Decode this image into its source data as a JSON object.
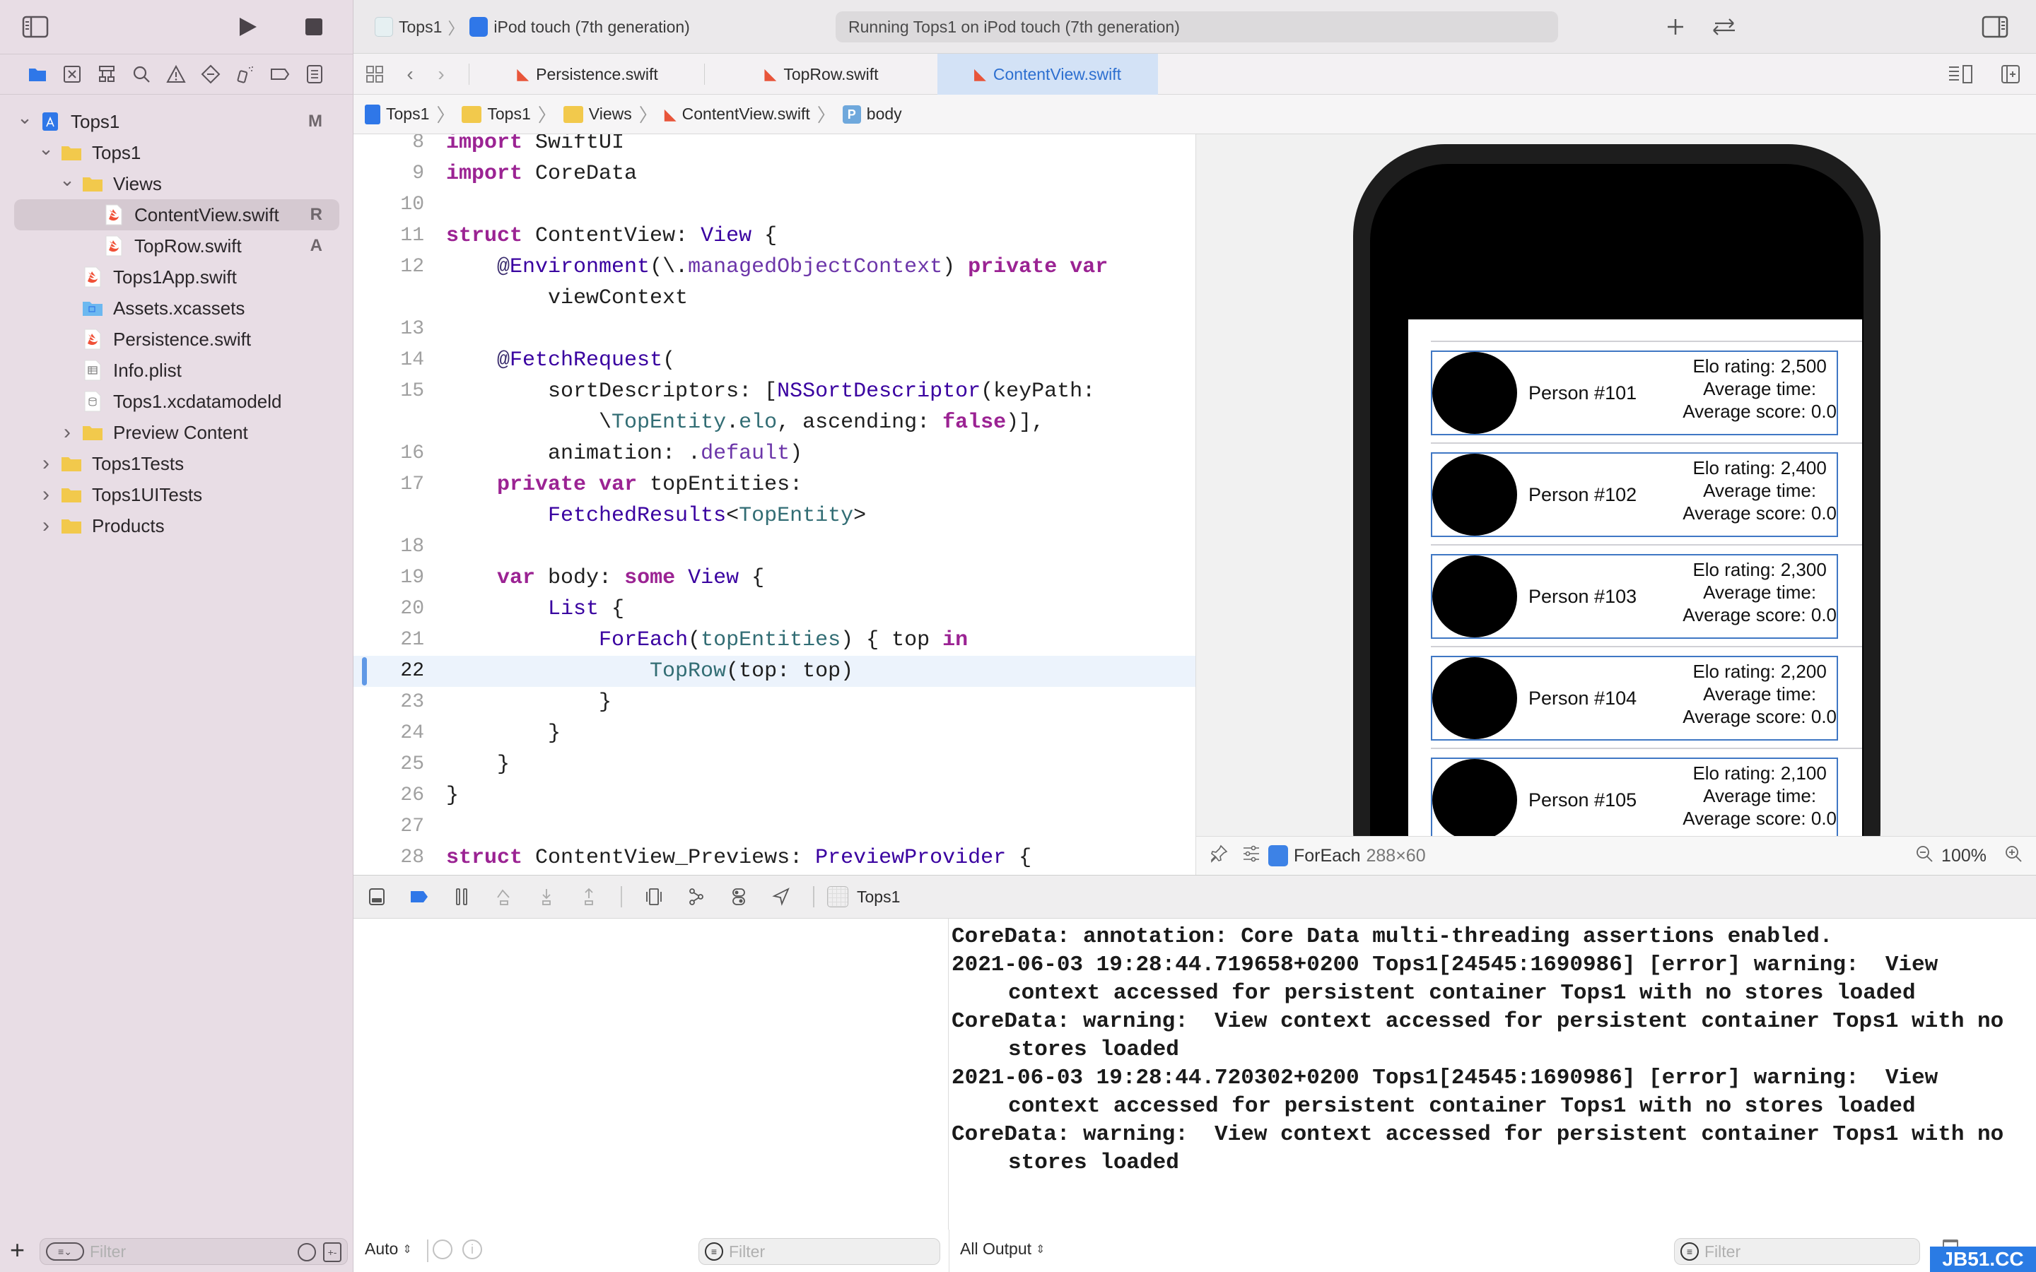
{
  "toolbar": {
    "scheme_project": "Tops1",
    "scheme_device": "iPod touch (7th generation)",
    "activity_status": "Running Tops1 on iPod touch (7th generation)"
  },
  "navigator": {
    "tree": [
      {
        "label": "Tops1",
        "level": 0,
        "expanded": true,
        "icon": "project-icon",
        "badge": "M"
      },
      {
        "label": "Tops1",
        "level": 1,
        "expanded": true,
        "icon": "folder-icon"
      },
      {
        "label": "Views",
        "level": 2,
        "expanded": true,
        "icon": "folder-icon"
      },
      {
        "label": "ContentView.swift",
        "level": 3,
        "icon": "swift-file-icon",
        "badge": "R",
        "selected": true
      },
      {
        "label": "TopRow.swift",
        "level": 3,
        "icon": "swift-file-icon",
        "badge": "A"
      },
      {
        "label": "Tops1App.swift",
        "level": 2,
        "icon": "swift-file-icon"
      },
      {
        "label": "Assets.xcassets",
        "level": 2,
        "icon": "assets-folder-icon"
      },
      {
        "label": "Persistence.swift",
        "level": 2,
        "icon": "swift-file-icon"
      },
      {
        "label": "Info.plist",
        "level": 2,
        "icon": "plist-file-icon"
      },
      {
        "label": "Tops1.xcdatamodeld",
        "level": 2,
        "icon": "datamodel-file-icon"
      },
      {
        "label": "Preview Content",
        "level": 2,
        "expanded": false,
        "icon": "folder-icon"
      },
      {
        "label": "Tops1Tests",
        "level": 1,
        "expanded": false,
        "icon": "folder-icon"
      },
      {
        "label": "Tops1UITests",
        "level": 1,
        "expanded": false,
        "icon": "folder-icon"
      },
      {
        "label": "Products",
        "level": 1,
        "expanded": false,
        "icon": "folder-icon"
      }
    ],
    "filter_placeholder": "Filter"
  },
  "tabs": [
    {
      "label": "Persistence.swift",
      "active": false
    },
    {
      "label": "TopRow.swift",
      "active": false
    },
    {
      "label": "ContentView.swift",
      "active": true
    }
  ],
  "breadcrumb": [
    "Tops1",
    "Tops1",
    "Views",
    "ContentView.swift",
    "body"
  ],
  "editor": {
    "current_line": 22,
    "lines": [
      {
        "n": "8",
        "html": "<span class=\"kw\">import</span> SwiftUI"
      },
      {
        "n": "9",
        "html": "<span class=\"kw\">import</span> CoreData"
      },
      {
        "n": "10",
        "html": ""
      },
      {
        "n": "11",
        "html": "<span class=\"kw\">struct</span> ContentView: <span class=\"ty\">View</span> {"
      },
      {
        "n": "12",
        "html": "    <span class=\"at\">@</span><span class=\"ty\">Environment</span>(\\.<span class=\"pr\">managedObjectContext</span>) <span class=\"kw\">private</span> <span class=\"kw\">var</span>"
      },
      {
        "n": "",
        "html": "        viewContext"
      },
      {
        "n": "13",
        "html": ""
      },
      {
        "n": "14",
        "html": "    <span class=\"at\">@</span><span class=\"ty\">FetchRequest</span>("
      },
      {
        "n": "15",
        "html": "        sortDescriptors: [<span class=\"ty\">NSSortDescriptor</span>(keyPath:"
      },
      {
        "n": "",
        "html": "            \\<span class=\"tp\">TopEntity</span>.<span class=\"tp\">elo</span>, ascending: <span class=\"kw\">false</span>)],"
      },
      {
        "n": "16",
        "html": "        animation: .<span class=\"pr\">default</span>)"
      },
      {
        "n": "17",
        "html": "    <span class=\"kw\">private</span> <span class=\"kw\">var</span> topEntities:"
      },
      {
        "n": "",
        "html": "        <span class=\"ty\">FetchedResults</span>&lt;<span class=\"tp\">TopEntity</span>&gt;"
      },
      {
        "n": "18",
        "html": ""
      },
      {
        "n": "19",
        "html": "    <span class=\"kw\">var</span> body: <span class=\"kw\">some</span> <span class=\"ty\">View</span> {"
      },
      {
        "n": "20",
        "html": "        <span class=\"ty\">List</span> {"
      },
      {
        "n": "21",
        "html": "            <span class=\"ty\">ForEach</span>(<span class=\"tp\">topEntities</span>) { top <span class=\"kw\">in</span>"
      },
      {
        "n": "22",
        "html": "                <span class=\"tp\">TopRow</span>(top: top)"
      },
      {
        "n": "23",
        "html": "            }"
      },
      {
        "n": "24",
        "html": "        }"
      },
      {
        "n": "25",
        "html": "    }"
      },
      {
        "n": "26",
        "html": "}"
      },
      {
        "n": "27",
        "html": ""
      },
      {
        "n": "28",
        "html": "<span class=\"kw\">struct</span> ContentView_Previews: <span class=\"ty\">PreviewProvider</span> {"
      }
    ]
  },
  "preview": {
    "rows": [
      {
        "name": "Person #101",
        "elo": "Elo rating: 2,500",
        "time": "Average time:",
        "score": "Average score: 0.0"
      },
      {
        "name": "Person #102",
        "elo": "Elo rating: 2,400",
        "time": "Average time:",
        "score": "Average score: 0.0"
      },
      {
        "name": "Person #103",
        "elo": "Elo rating: 2,300",
        "time": "Average time:",
        "score": "Average score: 0.0"
      },
      {
        "name": "Person #104",
        "elo": "Elo rating: 2,200",
        "time": "Average time:",
        "score": "Average score: 0.0"
      },
      {
        "name": "Person #105",
        "elo": "Elo rating: 2,100",
        "time": "Average time:",
        "score": "Average score: 0.0"
      }
    ],
    "selection_name": "ForEach",
    "selection_size": "288×60",
    "zoom": "100%"
  },
  "debugbar": {
    "target": "Tops1"
  },
  "console": {
    "lines": [
      "CoreData: annotation: Core Data multi-threading assertions enabled.",
      "2021-06-03 19:28:44.719658+0200 Tops1[24545:1690986] [error] warning:  View context accessed for persistent container Tops1 with no stores loaded",
      "CoreData: warning:  View context accessed for persistent container Tops1 with no stores loaded",
      "2021-06-03 19:28:44.720302+0200 Tops1[24545:1690986] [error] warning:  View context accessed for persistent container Tops1 with no stores loaded",
      "CoreData: warning:  View context accessed for persistent container Tops1 with no stores loaded"
    ]
  },
  "bottombar": {
    "variables_mode": "Auto",
    "variables_filter_placeholder": "Filter",
    "output_mode": "All Output",
    "console_filter_placeholder": "Filter"
  },
  "watermark": "JB51.CC",
  "colors": {
    "accent": "#2d6fd0",
    "selection_border": "#3f77c4",
    "keyword": "#9b2393",
    "type": "#3900a0"
  }
}
